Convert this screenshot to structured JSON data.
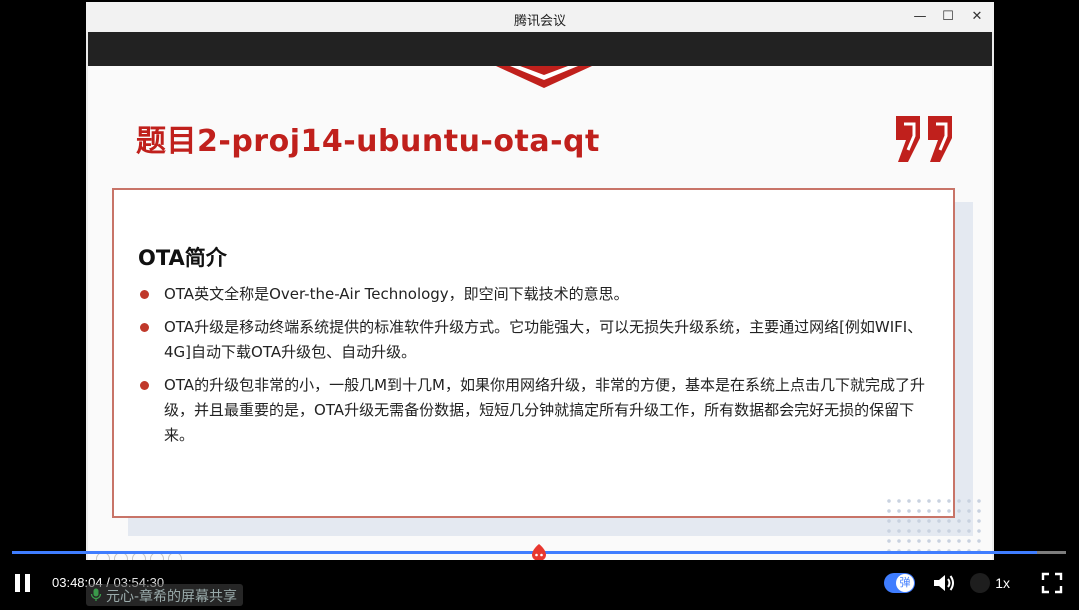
{
  "window": {
    "title": "腾讯会议",
    "min_glyph": "—",
    "max_glyph": "☐",
    "close_glyph": "✕"
  },
  "slide": {
    "title": "题目2-proj14-ubuntu-ota-qt",
    "heading": "OTA简介",
    "bullets": [
      "OTA英文全称是Over-the-Air Technology，即空间下载技术的意思。",
      "OTA升级是移动终端系统提供的标准软件升级方式。它功能强大，可以无损失升级系统，主要通过网络[例如WIFI、4G]自动下载OTA升级包、自动升级。",
      "OTA的升级包非常的小，一般几M到十几M，如果你用网络升级，非常的方便，基本是在系统上点击几下就完成了升级，并且最重要的是，OTA升级无需备份数据，短短几分钟就搞定所有升级工作，所有数据都会完好无损的保留下来。"
    ],
    "accent_color": "#c0201c"
  },
  "player": {
    "current_time": "03:48:04",
    "separator": " / ",
    "total_time": "03:54:30",
    "progress": 0.9726,
    "share_label": "元心-章希的屏幕共享",
    "danmaku_label": "弹",
    "speed_label": "1x",
    "accent_color": "#3f7dff"
  },
  "icons": {
    "pause": "pause-icon",
    "volume": "volume-icon",
    "fullscreen": "fullscreen-icon",
    "progress_thumb": "progress-thumb-icon"
  }
}
